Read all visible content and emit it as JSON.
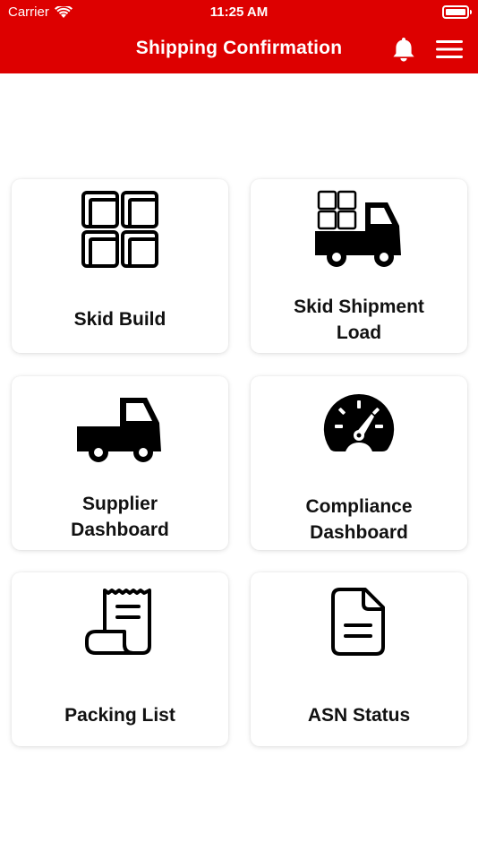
{
  "status_bar": {
    "carrier": "Carrier",
    "time": "11:25 AM"
  },
  "header": {
    "title": "Shipping Confirmation",
    "bell_icon": "bell-icon",
    "menu_icon": "hamburger-menu-icon",
    "background_color": "#dd0000"
  },
  "tiles": [
    {
      "label_lines": [
        "Skid Build"
      ],
      "icon": "grid-skid-icon"
    },
    {
      "label_lines": [
        "Skid Shipment",
        "Load"
      ],
      "icon": "truck-with-boxes-icon"
    },
    {
      "label_lines": [
        "Supplier",
        "Dashboard"
      ],
      "icon": "truck-icon"
    },
    {
      "label_lines": [
        "Compliance",
        "Dashboard"
      ],
      "icon": "speedometer-icon"
    },
    {
      "label_lines": [
        "Packing List"
      ],
      "icon": "receipt-scroll-icon"
    },
    {
      "label_lines": [
        "ASN Status"
      ],
      "icon": "document-icon"
    }
  ]
}
